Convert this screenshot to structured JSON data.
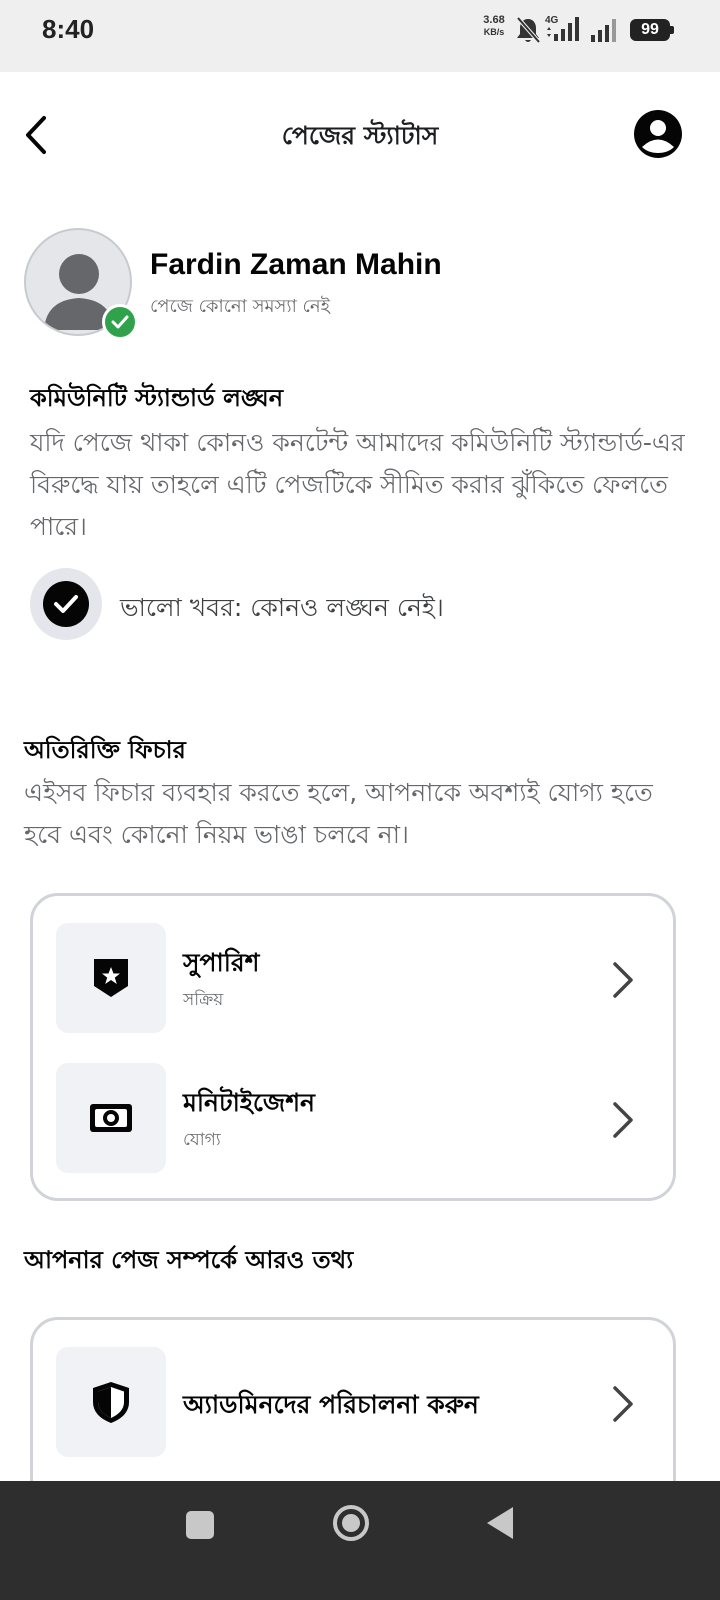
{
  "status_bar": {
    "time": "8:40",
    "net_speed_value": "3.68",
    "net_speed_unit": "KB/s",
    "network_type": "4G",
    "battery": "99",
    "icons": [
      "bell-off-icon",
      "signal-icon",
      "signal-icon",
      "battery-icon"
    ]
  },
  "header": {
    "title": "পেজের স্ট্যাটাস",
    "back_icon": "chevron-left-icon",
    "profile_icon": "account-circle-icon"
  },
  "profile": {
    "name": "Fardin Zaman Mahin",
    "status": "পেজে কোনো সমস্যা নেই",
    "verified_color": "#31a24c"
  },
  "community_standards": {
    "heading": "কমিউনিটি স্ট্যান্ডার্ড লঙ্ঘন",
    "description": "যদি পেজে থাকা কোনও কনটেন্ট আমাদের কমিউনিটি স্ট্যান্ডার্ড-এর বিরুদ্ধে যায় তাহলে এটি পেজটিকে সীমিত করার ঝুঁকিতে ফেলতে পারে।",
    "good_news": "ভালো খবর: কোনও লঙ্ঘন নেই।"
  },
  "extra_features": {
    "heading": "অতিরিক্তি ফিচার",
    "description": "এইসব ফিচার ব্যবহার করতে হলে, আপনাকে অবশ্যই যোগ্য হতে হবে এবং কোনো নিয়ম ভাঙা চলবে না।",
    "items": [
      {
        "title": "সুপারিশ",
        "subtitle": "সক্রিয়",
        "icon": "star-shield-icon"
      },
      {
        "title": "মনিটাইজেশন",
        "subtitle": "যোগ্য",
        "icon": "cash-icon"
      }
    ]
  },
  "more_info": {
    "heading": "আপনার পেজ সম্পর্কে আরও তথ্য",
    "items": [
      {
        "title": "অ্যাডমিনদের পরিচালনা করুন",
        "icon": "shield-icon"
      }
    ]
  },
  "nav_bar": {
    "icons": [
      "recents-icon",
      "home-icon",
      "back-icon"
    ]
  }
}
